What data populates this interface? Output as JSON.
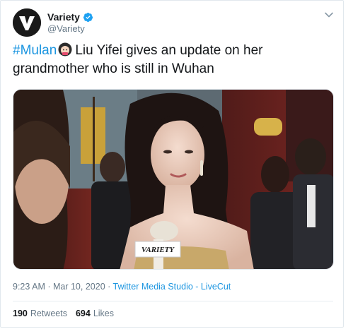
{
  "author": {
    "display_name": "Variety",
    "handle": "@Variety",
    "avatar_icon": "variety-logo-icon",
    "verified_icon": "verified-badge-icon"
  },
  "tweet": {
    "hashtag": "#Mulan",
    "emoji_icon": "woman-emoji-icon",
    "text": "Liu Yifei gives an update on her grandmother who is still in Wuhan"
  },
  "media": {
    "type": "video",
    "mic_flag_text": "VARIETY"
  },
  "meta": {
    "time": "9:23 AM",
    "separator1": " · ",
    "date": "Mar 10, 2020",
    "separator2": " · ",
    "source": "Twitter Media Studio - LiveCut"
  },
  "stats": {
    "retweets_count": "190",
    "retweets_label": "Retweets",
    "likes_count": "694",
    "likes_label": "Likes"
  },
  "colors": {
    "link": "#1b95e0",
    "secondary": "#657786",
    "text": "#14171a"
  }
}
